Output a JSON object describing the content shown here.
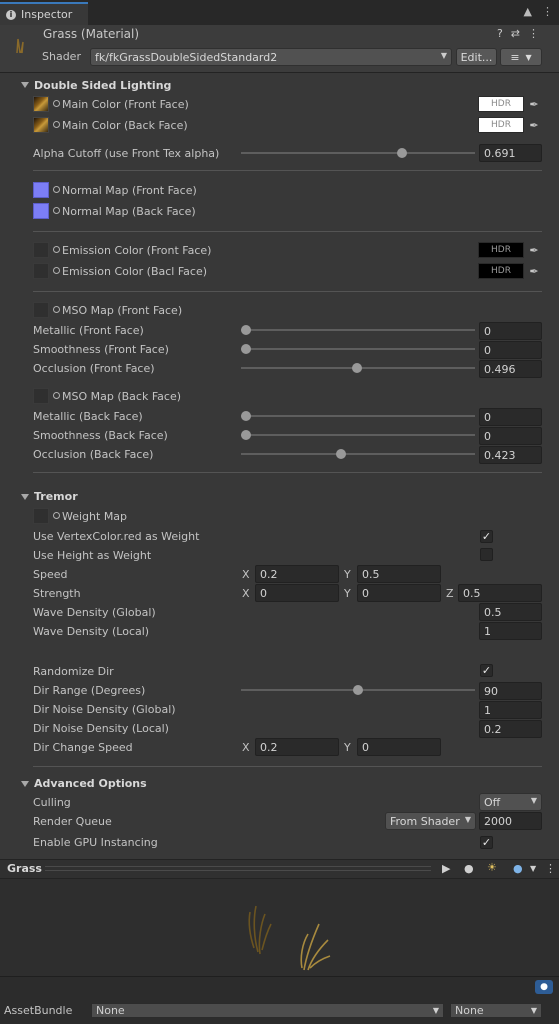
{
  "tab": {
    "title": "Inspector",
    "info_icon": "info-icon"
  },
  "header": {
    "title": "Grass (Material)",
    "shader_label": "Shader",
    "shader_value": "fk/fkGrassDoubleSidedStandard2",
    "edit_button": "Edit..."
  },
  "double_sided": {
    "title": "Double Sided Lighting",
    "main_front": "Main Color (Front Face)",
    "main_back": "Main Color (Back Face)",
    "hdr": "HDR",
    "alpha_cutoff_label": "Alpha Cutoff (use Front Tex alpha)",
    "alpha_cutoff_value": "0.691",
    "alpha_cutoff_fraction": 0.691,
    "normal_front": "Normal Map (Front Face)",
    "normal_back": "Normal Map (Back Face)",
    "emission_front": "Emission Color (Front Face)",
    "emission_back": "Emission Color (Bacl Face)",
    "mso_front": "MSO Map (Front Face)",
    "metallic_front_label": "Metallic (Front Face)",
    "metallic_front_value": "0",
    "smooth_front_label": "Smoothness (Front Face)",
    "smooth_front_value": "0",
    "occl_front_label": "Occlusion (Front Face)",
    "occl_front_value": "0.496",
    "mso_back": "MSO Map (Back Face)",
    "metallic_back_label": "Metallic (Back Face)",
    "metallic_back_value": "0",
    "smooth_back_label": "Smoothness (Back Face)",
    "smooth_back_value": "0",
    "occl_back_label": "Occlusion (Back Face)",
    "occl_back_value": "0.423"
  },
  "tremor": {
    "title": "Tremor",
    "weight_map": "Weight Map",
    "use_vertex_color": "Use VertexColor.red as Weight",
    "use_vertex_color_checked": true,
    "use_height": "Use Height as Weight",
    "use_height_checked": false,
    "speed_label": "Speed",
    "speed_x": "0.2",
    "speed_y": "0.5",
    "strength_label": "Strength",
    "strength_x": "0",
    "strength_y": "0",
    "strength_z": "0.5",
    "wave_global_label": "Wave Density (Global)",
    "wave_global_value": "0.5",
    "wave_local_label": "Wave Density (Local)",
    "wave_local_value": "1",
    "randomize_dir": "Randomize Dir",
    "randomize_dir_checked": true,
    "dir_range_label": "Dir Range (Degrees)",
    "dir_range_value": "90",
    "dir_noise_global_label": "Dir Noise Density (Global)",
    "dir_noise_global_value": "1",
    "dir_noise_local_label": "Dir Noise Density (Local)",
    "dir_noise_local_value": "0.2",
    "dir_change_label": "Dir Change Speed",
    "dir_change_x": "0.2",
    "dir_change_y": "0",
    "x": "X",
    "y": "Y",
    "z": "Z"
  },
  "advanced": {
    "title": "Advanced Options",
    "culling_label": "Culling",
    "culling_value": "Off",
    "render_queue_label": "Render Queue",
    "render_queue_source": "From Shader",
    "render_queue_value": "2000",
    "gpu_label": "Enable GPU Instancing",
    "gpu_checked": true
  },
  "preview": {
    "title": "Grass"
  },
  "asset_bundle": {
    "label": "AssetBundle",
    "name_value": "None",
    "variant_value": "None"
  }
}
